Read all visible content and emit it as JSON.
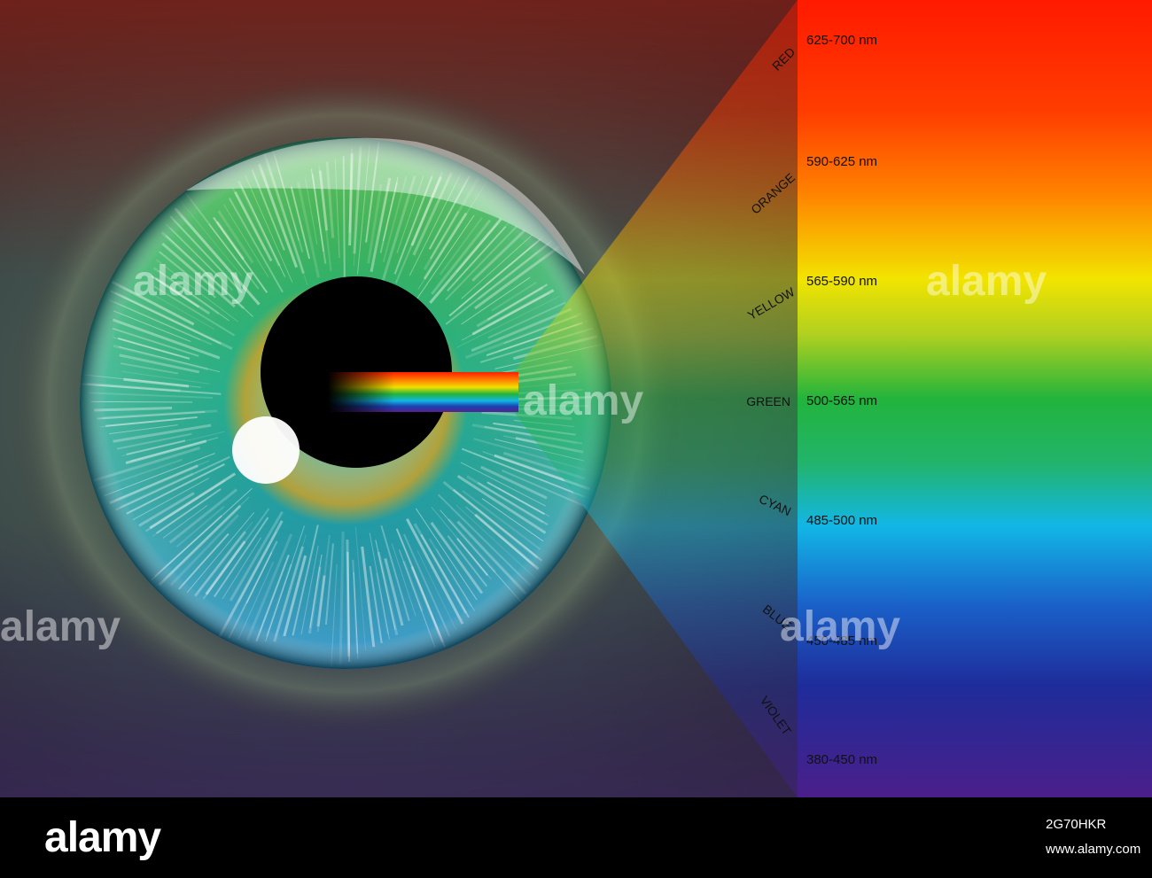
{
  "spectrum": {
    "bands": [
      {
        "name": "RED",
        "range": "625-700 nm",
        "color": "#ff1a00"
      },
      {
        "name": "ORANGE",
        "range": "590-625 nm",
        "color": "#ff7a00"
      },
      {
        "name": "YELLOW",
        "range": "565-590 nm",
        "color": "#f2e400"
      },
      {
        "name": "GREEN",
        "range": "500-565 nm",
        "color": "#22b43c"
      },
      {
        "name": "CYAN",
        "range": "485-500 nm",
        "color": "#12b6e6"
      },
      {
        "name": "BLUE",
        "range": "450-485 nm",
        "color": "#1a40b0"
      },
      {
        "name": "VIOLET",
        "range": "380-450 nm",
        "color": "#4b1f8a"
      }
    ]
  },
  "colors": {
    "iris_outer": "#1fa7c8",
    "iris_inner": "#3fb33a",
    "iris_ring": "#c9a12a",
    "pupil": "#000000"
  },
  "watermark": {
    "text": "alamy"
  },
  "footer": {
    "brand": "alamy",
    "image_code": "2G70HKR",
    "url": "www.alamy.com"
  }
}
